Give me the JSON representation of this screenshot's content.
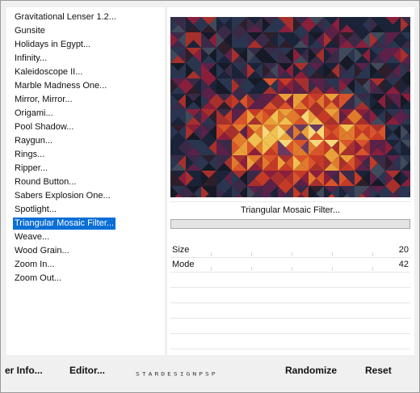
{
  "filters": {
    "items": [
      "Gravitational Lenser 1.2...",
      "Gunsite",
      "Holidays in Egypt...",
      "Infinity...",
      "Kaleidoscope II...",
      "Marble Madness One...",
      "Mirror, Mirror...",
      "Origami...",
      "Pool Shadow...",
      "Raygun...",
      "Rings...",
      "Ripper...",
      "Round Button...",
      "Sabers Explosion One...",
      "Spotlight...",
      "Triangular Mosaic Filter...",
      "Weave...",
      "Wood Grain...",
      "Zoom In...",
      "Zoom Out..."
    ],
    "selected": "Triangular Mosaic Filter..."
  },
  "preview": {
    "filter_name": "Triangular Mosaic Filter...",
    "palette": [
      "#1b2338",
      "#2a3550",
      "#3a2a48",
      "#5b2148",
      "#8a1f3c",
      "#a8302c",
      "#c53a26",
      "#d9542a",
      "#e07a2c",
      "#e9a03a",
      "#f0c050",
      "#f6d77a",
      "#6a3a60",
      "#2d1e2a",
      "#151a26",
      "#404a5a"
    ]
  },
  "params": [
    {
      "name": "Size",
      "value": "20"
    },
    {
      "name": "Mode",
      "value": "42"
    }
  ],
  "buttons": {
    "user_info": "er Info...",
    "editor": "Editor...",
    "randomize": "Randomize",
    "reset": "Reset"
  },
  "watermark": "STARDESIGNPSP"
}
